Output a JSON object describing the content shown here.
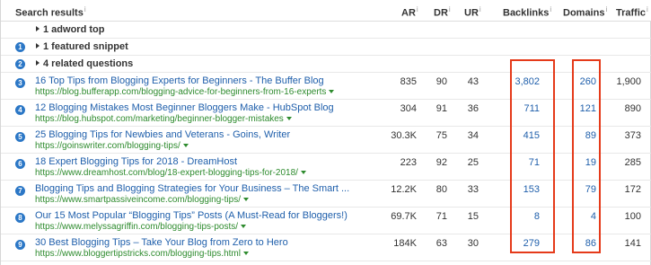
{
  "header": {
    "search_results": "Search results",
    "ar": "AR",
    "dr": "DR",
    "ur": "UR",
    "backlinks": "Backlinks",
    "domains": "Domains",
    "traffic": "Traffic",
    "info_glyph": "i"
  },
  "features": [
    {
      "text": "1 adword top",
      "badge": ""
    },
    {
      "text": "1 featured snippet",
      "badge": "1"
    },
    {
      "text": "4 related questions",
      "badge": "2"
    }
  ],
  "results": [
    {
      "rank": "3",
      "title": "16 Top Tips from Blogging Experts for Beginners - The Buffer Blog",
      "url": "https://blog.bufferapp.com/blogging-advice-for-beginners-from-16-experts",
      "ar": "835",
      "dr": "90",
      "ur": "43",
      "backlinks": "3,802",
      "domains": "260",
      "traffic": "1,900"
    },
    {
      "rank": "4",
      "title": "12 Blogging Mistakes Most Beginner Bloggers Make - HubSpot Blog",
      "url": "https://blog.hubspot.com/marketing/beginner-blogger-mistakes",
      "ar": "304",
      "dr": "91",
      "ur": "36",
      "backlinks": "711",
      "domains": "121",
      "traffic": "890"
    },
    {
      "rank": "5",
      "title": "25 Blogging Tips for Newbies and Veterans - Goins, Writer",
      "url": "https://goinswriter.com/blogging-tips/",
      "ar": "30.3K",
      "dr": "75",
      "ur": "34",
      "backlinks": "415",
      "domains": "89",
      "traffic": "373"
    },
    {
      "rank": "6",
      "title": "18 Expert Blogging Tips for 2018 - DreamHost",
      "url": "https://www.dreamhost.com/blog/18-expert-blogging-tips-for-2018/",
      "ar": "223",
      "dr": "92",
      "ur": "25",
      "backlinks": "71",
      "domains": "19",
      "traffic": "285"
    },
    {
      "rank": "7",
      "title": "Blogging Tips and Blogging Strategies for Your Business – The Smart ...",
      "url": "https://www.smartpassiveincome.com/blogging-tips/",
      "ar": "12.2K",
      "dr": "80",
      "ur": "33",
      "backlinks": "153",
      "domains": "79",
      "traffic": "172"
    },
    {
      "rank": "8",
      "title": "Our 15 Most Popular “Blogging Tips” Posts (A Must-Read for Bloggers!)",
      "url": "https://www.melyssagriffin.com/blogging-tips-posts/",
      "ar": "69.7K",
      "dr": "71",
      "ur": "15",
      "backlinks": "8",
      "domains": "4",
      "traffic": "100"
    },
    {
      "rank": "9",
      "title": "30 Best Blogging Tips – Take Your Blog from Zero to Hero",
      "url": "https://www.bloggertipstricks.com/blogging-tips.html",
      "ar": "184K",
      "dr": "63",
      "ur": "30",
      "backlinks": "279",
      "domains": "86",
      "traffic": "141"
    }
  ],
  "colors": {
    "link": "#1f5fab",
    "url": "#2e8b2e",
    "badge": "#2b77c6",
    "highlight": "#e53a1a"
  }
}
